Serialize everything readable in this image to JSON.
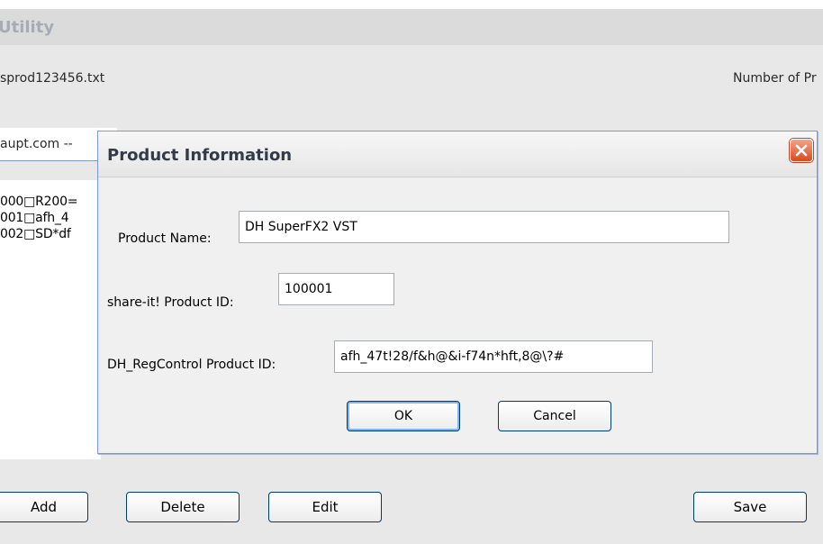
{
  "app": {
    "title": "Utility"
  },
  "main": {
    "file_name": "sprod123456.txt",
    "count_label": "Number of Pr",
    "site_combo": "aupt.com --",
    "list_items": [
      "000□R200=",
      "001□afh_4",
      "002□SD*df"
    ]
  },
  "buttons": {
    "add": "Add",
    "delete": "Delete",
    "edit": "Edit",
    "save": "Save"
  },
  "dialog": {
    "title": "Product Information",
    "product_name_label": "Product Name:",
    "product_name_value": "DH SuperFX2 VST",
    "shareit_label": "share-it! Product ID:",
    "shareit_value": "100001",
    "regcontrol_label": "DH_RegControl Product ID:",
    "regcontrol_value": "afh_47t!28/f&h@&i-f74n*hft,8@\\?#",
    "ok": "OK",
    "cancel": "Cancel",
    "close_icon": "close-icon"
  },
  "colors": {
    "close_button": "#d84a1f",
    "button_border": "#003c74",
    "title_text": "#a6acb6"
  }
}
